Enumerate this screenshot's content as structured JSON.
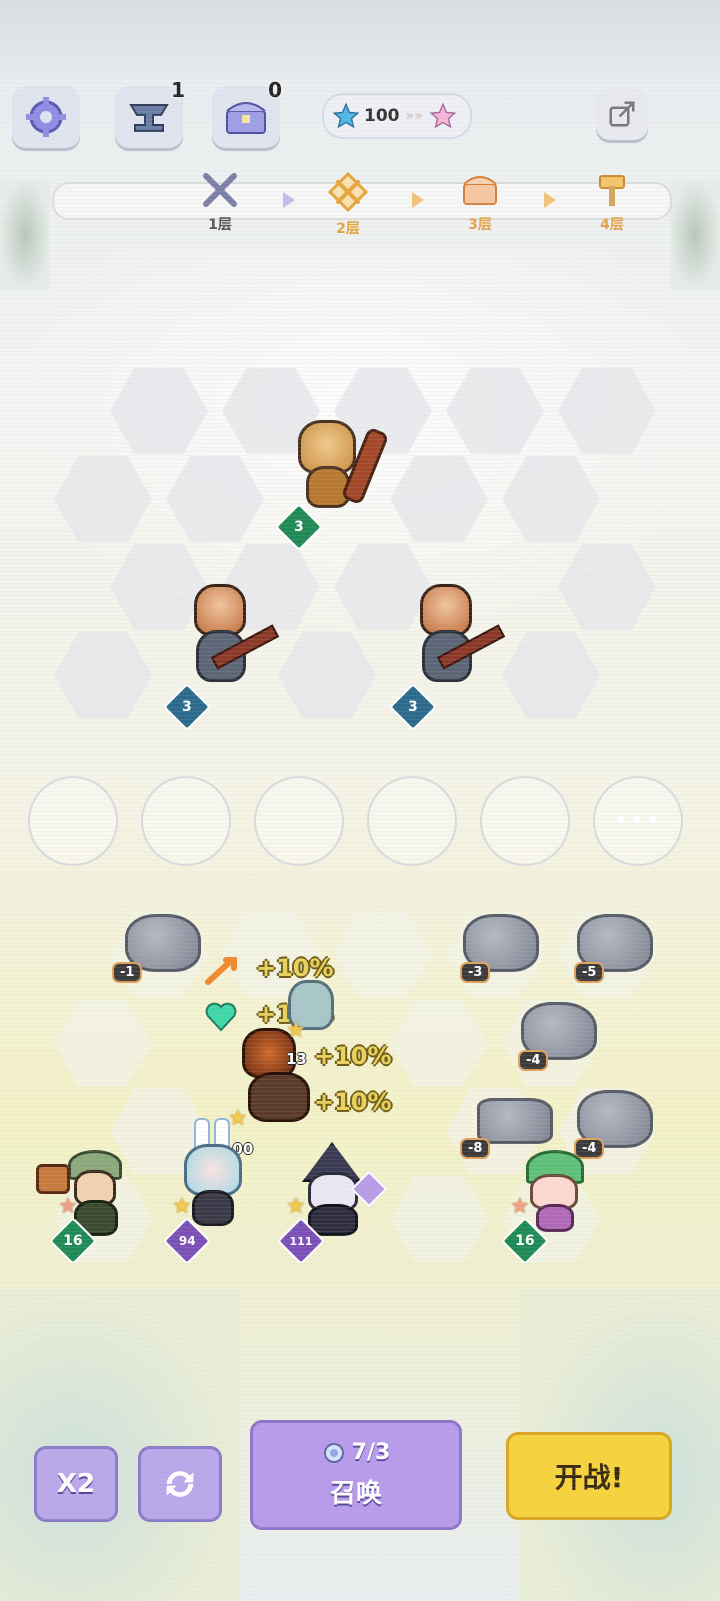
{
  "top_bar": {
    "settings_icon": "gear-icon",
    "anvil_count": "1",
    "chest_count": "0",
    "star_value": "100",
    "share_icon": "share-icon"
  },
  "stages": [
    {
      "label": "1层",
      "icon": "crossed-swords-icon",
      "state": "done"
    },
    {
      "label": "2层",
      "icon": "battle-icon",
      "state": "current"
    },
    {
      "label": "3层",
      "icon": "chest-icon",
      "state": "upcoming"
    },
    {
      "label": "4层",
      "icon": "hammer-icon",
      "state": "upcoming"
    }
  ],
  "enemies": [
    {
      "name": "monkey-club-enemy",
      "level": "3"
    },
    {
      "name": "bandit-sword-enemy",
      "level": "3"
    },
    {
      "name": "bandit-sword-enemy",
      "level": "3"
    }
  ],
  "bench_more": "•••",
  "rocks": [
    "-1",
    "-3",
    "-5",
    "-4",
    "-8",
    "-4"
  ],
  "buffs": [
    "+10%",
    "+10%",
    "+10%",
    "+10%"
  ],
  "units": [
    {
      "name": "warrior-unit",
      "value": "100",
      "star_color": "#f5c84a"
    },
    {
      "name": "mage-unit",
      "value": "13",
      "star_color": "#f5c84a"
    },
    {
      "name": "axe-hunter-unit",
      "value": "16",
      "star_color": "#f0a08a"
    },
    {
      "name": "bunny-girl-unit",
      "value": "94",
      "star_color": "#f5c84a"
    },
    {
      "name": "witch-unit",
      "value": "111",
      "star_color": "#f5c84a"
    },
    {
      "name": "green-hat-girl-unit",
      "value": "16",
      "star_color": "#f0a08a"
    }
  ],
  "bottom": {
    "speed_label": "X2",
    "refresh_icon": "refresh-icon",
    "summon_cost": "7/3",
    "summon_label": "召唤",
    "fight_label": "开战!"
  },
  "colors": {
    "level_green": "#1f8a55",
    "level_blue": "#2b6a8c",
    "level_purple": "#7a4fb6",
    "summon_bg": "#b79bea",
    "fight_bg": "#f6d33c"
  }
}
